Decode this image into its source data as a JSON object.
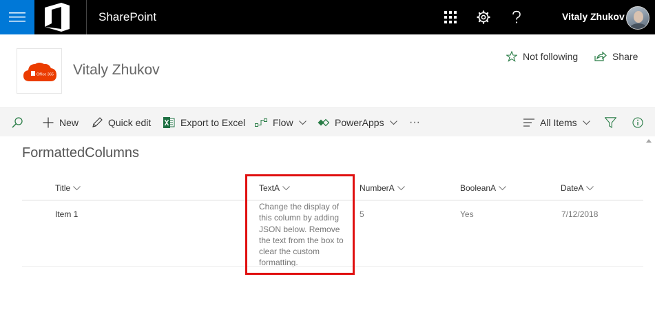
{
  "suite": {
    "app_name": "SharePoint",
    "user_name": "Vitaly Zhukov",
    "brand_color": "#0078d7"
  },
  "site": {
    "title": "Vitaly Zhukov",
    "logo_text": "Office 365",
    "logo_color": "#eb3c00",
    "not_following_label": "Not following",
    "share_label": "Share"
  },
  "commands": {
    "new_label": "New",
    "quick_edit_label": "Quick edit",
    "export_label": "Export to Excel",
    "flow_label": "Flow",
    "powerapps_label": "PowerApps",
    "more_label": "···",
    "view_label": "All Items"
  },
  "list": {
    "title": "FormattedColumns",
    "columns": [
      "Title",
      "TextA",
      "NumberA",
      "BooleanA",
      "DateA"
    ],
    "rows": [
      {
        "title": "Item 1",
        "text_a": "Change the display of this column by adding JSON below. Remove the text from the box to clear the custom formatting.",
        "number_a": "5",
        "boolean_a": "Yes",
        "date_a": "7/12/2018"
      }
    ]
  },
  "highlight_color": "#e01010"
}
